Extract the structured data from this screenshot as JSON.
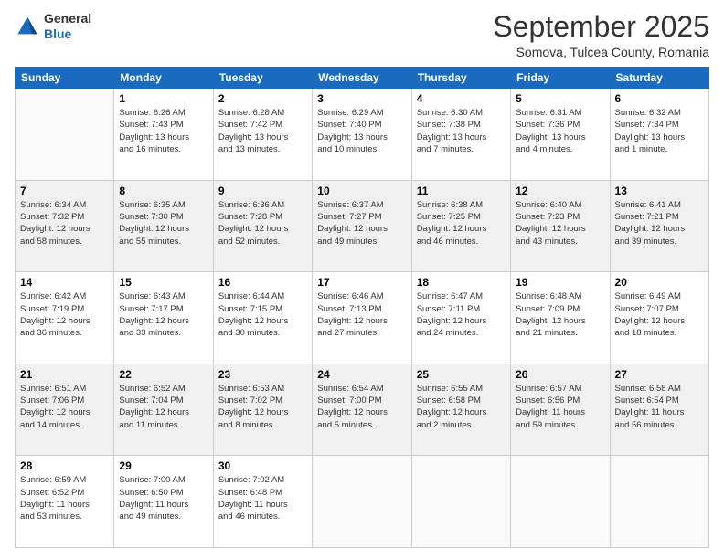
{
  "header": {
    "logo": {
      "general": "General",
      "blue": "Blue"
    },
    "title": "September 2025",
    "location": "Somova, Tulcea County, Romania"
  },
  "days_of_week": [
    "Sunday",
    "Monday",
    "Tuesday",
    "Wednesday",
    "Thursday",
    "Friday",
    "Saturday"
  ],
  "weeks": [
    [
      {
        "day": "",
        "info": ""
      },
      {
        "day": "1",
        "info": "Sunrise: 6:26 AM\nSunset: 7:43 PM\nDaylight: 13 hours\nand 16 minutes."
      },
      {
        "day": "2",
        "info": "Sunrise: 6:28 AM\nSunset: 7:42 PM\nDaylight: 13 hours\nand 13 minutes."
      },
      {
        "day": "3",
        "info": "Sunrise: 6:29 AM\nSunset: 7:40 PM\nDaylight: 13 hours\nand 10 minutes."
      },
      {
        "day": "4",
        "info": "Sunrise: 6:30 AM\nSunset: 7:38 PM\nDaylight: 13 hours\nand 7 minutes."
      },
      {
        "day": "5",
        "info": "Sunrise: 6:31 AM\nSunset: 7:36 PM\nDaylight: 13 hours\nand 4 minutes."
      },
      {
        "day": "6",
        "info": "Sunrise: 6:32 AM\nSunset: 7:34 PM\nDaylight: 13 hours\nand 1 minute."
      }
    ],
    [
      {
        "day": "7",
        "info": "Sunrise: 6:34 AM\nSunset: 7:32 PM\nDaylight: 12 hours\nand 58 minutes."
      },
      {
        "day": "8",
        "info": "Sunrise: 6:35 AM\nSunset: 7:30 PM\nDaylight: 12 hours\nand 55 minutes."
      },
      {
        "day": "9",
        "info": "Sunrise: 6:36 AM\nSunset: 7:28 PM\nDaylight: 12 hours\nand 52 minutes."
      },
      {
        "day": "10",
        "info": "Sunrise: 6:37 AM\nSunset: 7:27 PM\nDaylight: 12 hours\nand 49 minutes."
      },
      {
        "day": "11",
        "info": "Sunrise: 6:38 AM\nSunset: 7:25 PM\nDaylight: 12 hours\nand 46 minutes."
      },
      {
        "day": "12",
        "info": "Sunrise: 6:40 AM\nSunset: 7:23 PM\nDaylight: 12 hours\nand 43 minutes."
      },
      {
        "day": "13",
        "info": "Sunrise: 6:41 AM\nSunset: 7:21 PM\nDaylight: 12 hours\nand 39 minutes."
      }
    ],
    [
      {
        "day": "14",
        "info": "Sunrise: 6:42 AM\nSunset: 7:19 PM\nDaylight: 12 hours\nand 36 minutes."
      },
      {
        "day": "15",
        "info": "Sunrise: 6:43 AM\nSunset: 7:17 PM\nDaylight: 12 hours\nand 33 minutes."
      },
      {
        "day": "16",
        "info": "Sunrise: 6:44 AM\nSunset: 7:15 PM\nDaylight: 12 hours\nand 30 minutes."
      },
      {
        "day": "17",
        "info": "Sunrise: 6:46 AM\nSunset: 7:13 PM\nDaylight: 12 hours\nand 27 minutes."
      },
      {
        "day": "18",
        "info": "Sunrise: 6:47 AM\nSunset: 7:11 PM\nDaylight: 12 hours\nand 24 minutes."
      },
      {
        "day": "19",
        "info": "Sunrise: 6:48 AM\nSunset: 7:09 PM\nDaylight: 12 hours\nand 21 minutes."
      },
      {
        "day": "20",
        "info": "Sunrise: 6:49 AM\nSunset: 7:07 PM\nDaylight: 12 hours\nand 18 minutes."
      }
    ],
    [
      {
        "day": "21",
        "info": "Sunrise: 6:51 AM\nSunset: 7:06 PM\nDaylight: 12 hours\nand 14 minutes."
      },
      {
        "day": "22",
        "info": "Sunrise: 6:52 AM\nSunset: 7:04 PM\nDaylight: 12 hours\nand 11 minutes."
      },
      {
        "day": "23",
        "info": "Sunrise: 6:53 AM\nSunset: 7:02 PM\nDaylight: 12 hours\nand 8 minutes."
      },
      {
        "day": "24",
        "info": "Sunrise: 6:54 AM\nSunset: 7:00 PM\nDaylight: 12 hours\nand 5 minutes."
      },
      {
        "day": "25",
        "info": "Sunrise: 6:55 AM\nSunset: 6:58 PM\nDaylight: 12 hours\nand 2 minutes."
      },
      {
        "day": "26",
        "info": "Sunrise: 6:57 AM\nSunset: 6:56 PM\nDaylight: 11 hours\nand 59 minutes."
      },
      {
        "day": "27",
        "info": "Sunrise: 6:58 AM\nSunset: 6:54 PM\nDaylight: 11 hours\nand 56 minutes."
      }
    ],
    [
      {
        "day": "28",
        "info": "Sunrise: 6:59 AM\nSunset: 6:52 PM\nDaylight: 11 hours\nand 53 minutes."
      },
      {
        "day": "29",
        "info": "Sunrise: 7:00 AM\nSunset: 6:50 PM\nDaylight: 11 hours\nand 49 minutes."
      },
      {
        "day": "30",
        "info": "Sunrise: 7:02 AM\nSunset: 6:48 PM\nDaylight: 11 hours\nand 46 minutes."
      },
      {
        "day": "",
        "info": ""
      },
      {
        "day": "",
        "info": ""
      },
      {
        "day": "",
        "info": ""
      },
      {
        "day": "",
        "info": ""
      }
    ]
  ]
}
